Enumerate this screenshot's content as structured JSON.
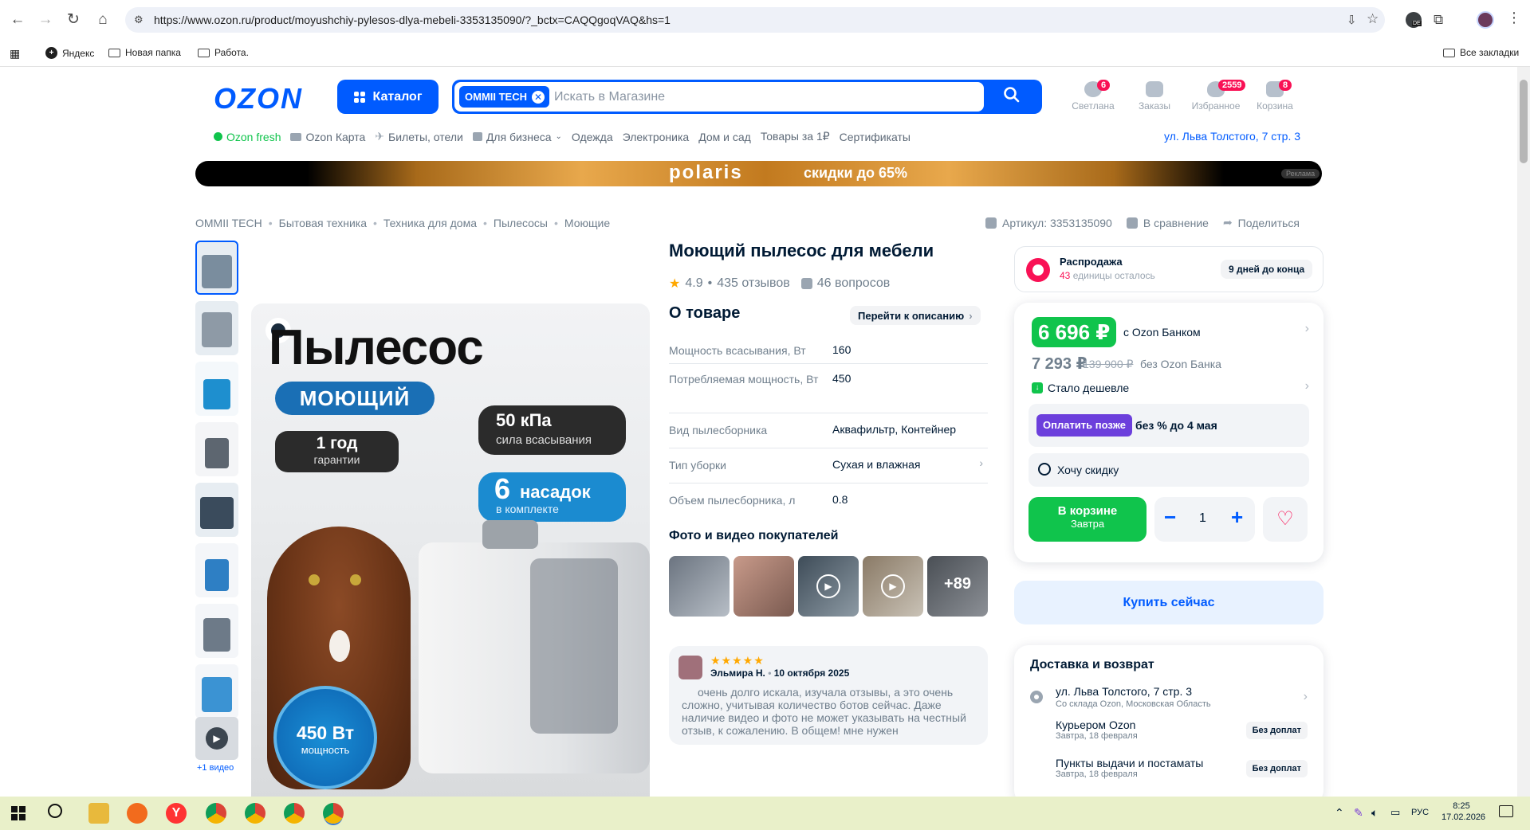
{
  "browser": {
    "url": "https://www.ozon.ru/product/moyushchiy-pylesos-dlya-mebeli-3353135090/?_bctx=CAQQgoqVAQ&hs=1",
    "ext_badge": "DE",
    "bookmarks": [
      "Яндекс",
      "Новая папка",
      "Работа."
    ],
    "all_bookmarks": "Все закладки"
  },
  "header": {
    "logo": "OZON",
    "catalog": "Каталог",
    "store_chip": "OMMII TECH",
    "search_placeholder": "Искать в Магазине",
    "icons": [
      {
        "label": "Светлана",
        "badge": "6"
      },
      {
        "label": "Заказы",
        "badge": ""
      },
      {
        "label": "Избранное",
        "badge": "2559"
      },
      {
        "label": "Корзина",
        "badge": "8"
      }
    ]
  },
  "nav": {
    "items": [
      "Ozon fresh",
      "Ozon Карта",
      "Билеты, отели",
      "Для бизнеса",
      "Одежда",
      "Электроника",
      "Дом и сад",
      "Товары за 1₽",
      "Сертификаты"
    ],
    "address": "ул. Льва Толстого, 7 стр. 3"
  },
  "banner": {
    "brand": "polaris",
    "promo": "скидки до 65%",
    "ad": "Реклама"
  },
  "breadcrumb": [
    "OMMII TECH",
    "Бытовая техника",
    "Техника для дома",
    "Пылесосы",
    "Моющие"
  ],
  "toplinks": {
    "article": "Артикул: 3353135090",
    "compare": "В сравнение",
    "share": "Поделиться"
  },
  "gallery": {
    "more_video": "+1 видео",
    "img_title": "Пылесос",
    "img_sub": "МОЮЩИЙ",
    "badge_power": "50 кПа",
    "badge_power_sub": "сила всасывания",
    "badge_warranty": "1 год",
    "badge_warranty_sub": "гарантии",
    "badge_nozzles": "6",
    "badge_nozzles_word": "насадок",
    "badge_nozzles_sub": "в комплекте",
    "circle_value": "450 Вт",
    "circle_sub": "мощность"
  },
  "product": {
    "title": "Моющий пылесос для мебели",
    "rating": "4.9",
    "reviews": "435 отзывов",
    "questions": "46 вопросов",
    "about": "О товаре",
    "to_description": "Перейти к описанию",
    "props": [
      {
        "k": "Мощность всасывания, Вт",
        "v": "160"
      },
      {
        "k": "Потребляемая мощность, Вт",
        "v": "450"
      },
      {
        "k": "Вид пылесборника",
        "v": "Аквафильтр, Контейнер"
      },
      {
        "k": "Тип уборки",
        "v": "Сухая и влажная"
      },
      {
        "k": "Объем пылесборника, л",
        "v": "0.8"
      }
    ],
    "photos_title": "Фото и видео покупателей",
    "photos_more": "+89",
    "review": {
      "author": "Эльмира Н.",
      "date": "10 октября 2025",
      "stars": "★★★★★",
      "text": "очень долго искала, изучала отзывы, а это очень сложно, учитывая количество ботов сейчас. Даже наличие видео и фото не может указывать на честный отзыв, к сожалению. В общем! мне нужен"
    }
  },
  "sale": {
    "title": "Распродажа",
    "left_count": "43",
    "left_text": "единицы осталось",
    "days": "9 дней до конца"
  },
  "price": {
    "card_price": "6 696 ₽",
    "card_label": "с Ozon Банком",
    "regular": "7 293 ₽",
    "old": "139 900 ₽",
    "regular_label": "без Ozon Банка",
    "cheaper": "Стало дешевле",
    "pay_later_btn": "Оплатить позже",
    "pay_later_text": "без % до 4 мая",
    "want_discount": "Хочу скидку",
    "in_cart": "В корзине",
    "in_cart_sub": "Завтра",
    "qty": "1",
    "buy_now": "Купить сейчас"
  },
  "delivery": {
    "title": "Доставка и возврат",
    "address": "ул. Льва Толстого, 7 стр. 3",
    "from": "Со склада Ozon, Московская Область",
    "options": [
      {
        "name": "Курьером Ozon",
        "when": "Завтра, 18 февраля",
        "price": "Без доплат"
      },
      {
        "name": "Пункты выдачи и постаматы",
        "when": "Завтра, 18 февраля",
        "price": "Без доплат"
      }
    ]
  },
  "taskbar": {
    "lang": "РУС",
    "time": "8:25",
    "date": "17.02.2026"
  },
  "colors": {
    "ozon_blue": "#005bff",
    "green": "#10c44c",
    "pink": "#f91155"
  }
}
